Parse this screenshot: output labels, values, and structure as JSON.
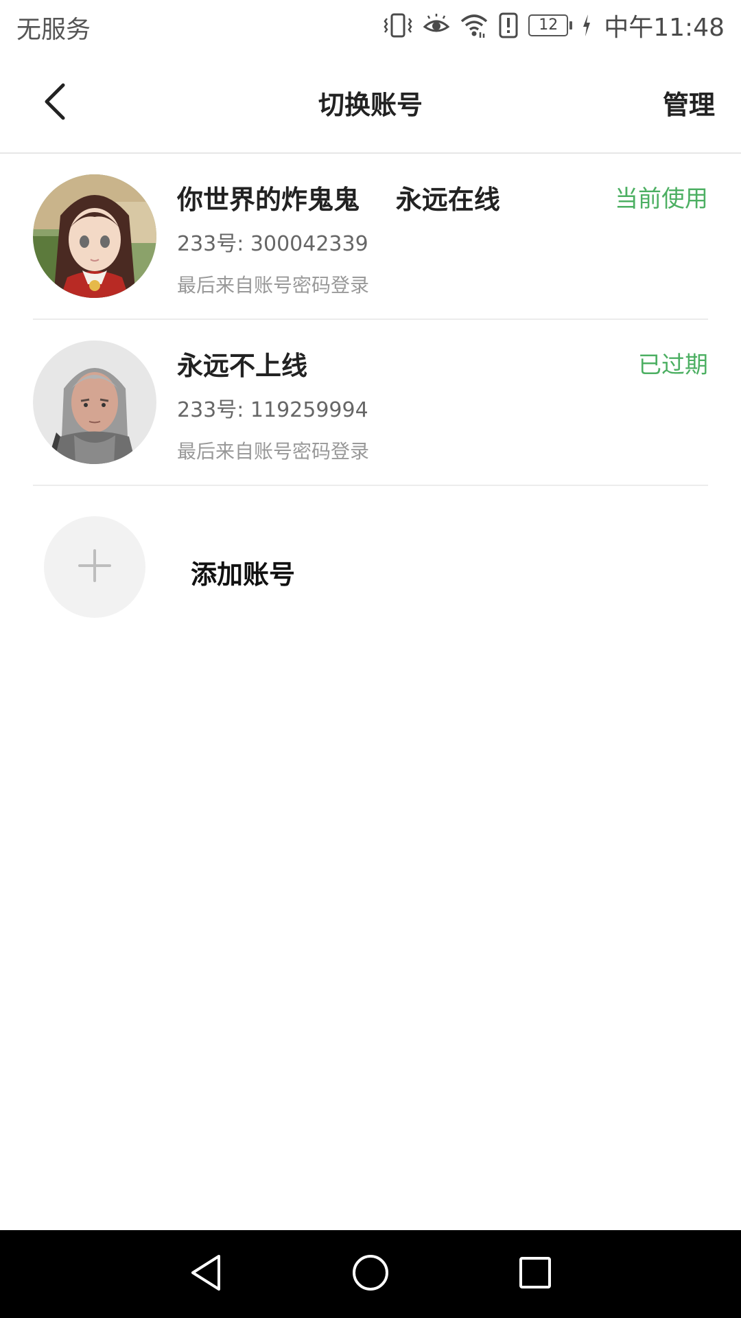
{
  "status_bar": {
    "carrier": "无服务",
    "battery_level": "12",
    "time": "中午11:48",
    "icons": [
      "vibrate-icon",
      "eye-icon",
      "wifi-icon",
      "alert-icon",
      "battery-icon",
      "charging-icon"
    ]
  },
  "header": {
    "title": "切换账号",
    "manage_label": "管理",
    "back_icon": "chevron-left-icon"
  },
  "accounts": [
    {
      "name": "你世界的炸鬼鬼    永远在线",
      "id_text": "233号: 300042339",
      "login_text": "最后来自账号密码登录",
      "status": "当前使用",
      "status_color": "#4caf62"
    },
    {
      "name": "永远不上线",
      "id_text": "233号: 119259994",
      "login_text": "最后来自账号密码登录",
      "status": "已过期",
      "status_color": "#4caf62"
    }
  ],
  "add_account": {
    "label": "添加账号",
    "icon": "plus-icon"
  },
  "nav_bar": {
    "icons": [
      "back-triangle-icon",
      "home-circle-icon",
      "recents-square-icon"
    ]
  }
}
